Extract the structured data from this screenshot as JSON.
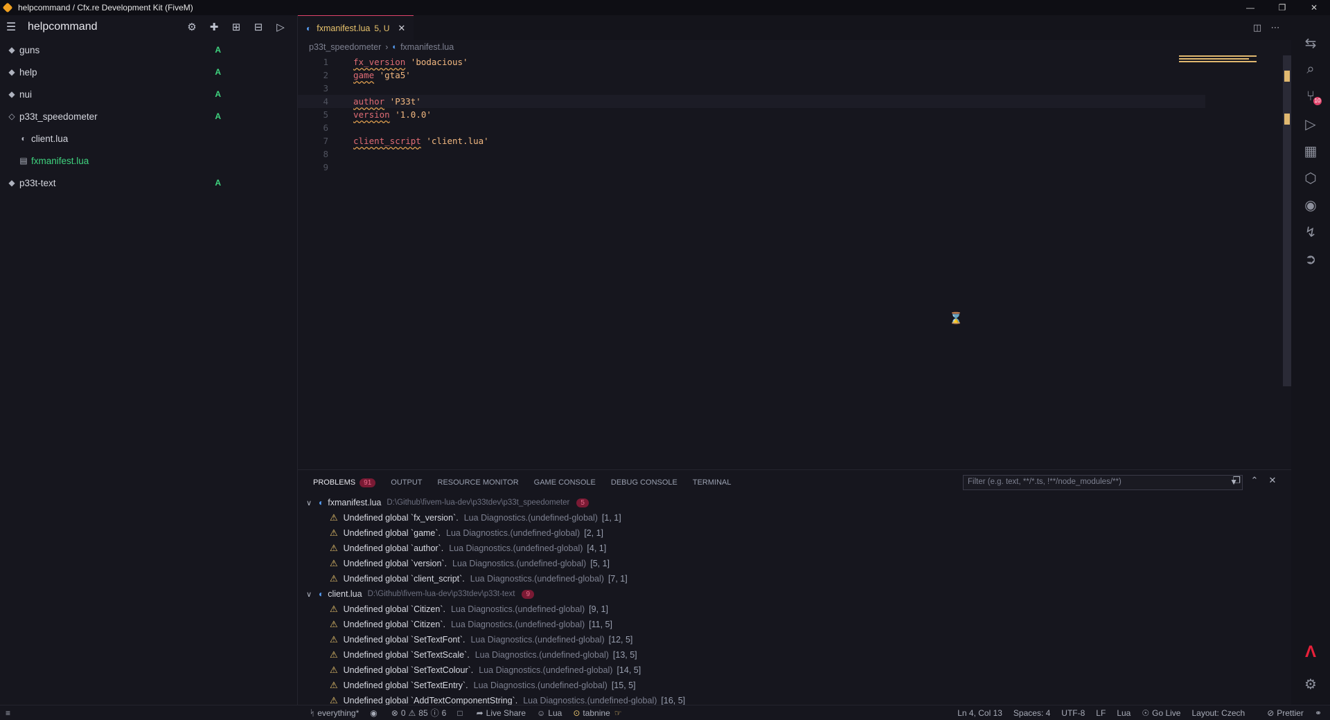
{
  "window": {
    "title": "helpcommand / Cfx.re Development Kit (FiveM)",
    "icon": "cfx-icon",
    "controls": [
      "minimize-icon",
      "restore-icon",
      "close-icon"
    ]
  },
  "sidebar": {
    "title": "helpcommand",
    "actions": [
      "gear-icon",
      "plus-icon",
      "import-icon",
      "export-icon",
      "play-icon"
    ],
    "items": [
      {
        "label": "guns",
        "badge": "A",
        "icon": "resource-icon",
        "level": 0
      },
      {
        "label": "help",
        "badge": "A",
        "icon": "resource-icon",
        "level": 0
      },
      {
        "label": "nui",
        "badge": "A",
        "icon": "resource-icon",
        "level": 0
      },
      {
        "label": "p33t_speedometer",
        "badge": "A",
        "icon": "resource-open-icon",
        "level": 0
      },
      {
        "label": "client.lua",
        "badge": "",
        "icon": "lua-file-icon",
        "level": 1
      },
      {
        "label": "fxmanifest.lua",
        "badge": "",
        "icon": "manifest-file-icon",
        "level": 1,
        "active": true
      },
      {
        "label": "p33t-text",
        "badge": "A",
        "icon": "resource-icon",
        "level": 0
      }
    ]
  },
  "editor": {
    "tab": {
      "label": "fxmanifest.lua",
      "status": "5, U"
    },
    "breadcrumb": {
      "folder": "p33t_speedometer",
      "file": "fxmanifest.lua"
    },
    "lines": [
      {
        "n": "1",
        "kw": "fx_version",
        "rest": " 'bodacious'"
      },
      {
        "n": "2",
        "kw": "game",
        "rest": " 'gta5'"
      },
      {
        "n": "3",
        "kw": "",
        "rest": ""
      },
      {
        "n": "4",
        "kw": "author",
        "rest": " 'P33t'"
      },
      {
        "n": "5",
        "kw": "version",
        "rest": " '1.0.0'"
      },
      {
        "n": "6",
        "kw": "",
        "rest": ""
      },
      {
        "n": "7",
        "kw": "client_script",
        "rest": " 'client.lua'"
      },
      {
        "n": "8",
        "kw": "",
        "rest": ""
      },
      {
        "n": "9",
        "kw": "",
        "rest": ""
      }
    ]
  },
  "panel": {
    "tabs": [
      {
        "label": "PROBLEMS",
        "badge": "91",
        "active": true
      },
      {
        "label": "OUTPUT"
      },
      {
        "label": "RESOURCE MONITOR"
      },
      {
        "label": "GAME CONSOLE"
      },
      {
        "label": "DEBUG CONSOLE"
      },
      {
        "label": "TERMINAL"
      }
    ],
    "filter_placeholder": "Filter (e.g. text, **/*.ts, !**/node_modules/**)",
    "groups": [
      {
        "file": "fxmanifest.lua",
        "path": "D:\\Github\\fivem-lua-dev\\p33tdev\\p33t_speedometer",
        "count": "5",
        "items": [
          {
            "msg": "Undefined global `fx_version`.",
            "src": "Lua Diagnostics.(undefined-global)",
            "pos": "[1, 1]"
          },
          {
            "msg": "Undefined global `game`.",
            "src": "Lua Diagnostics.(undefined-global)",
            "pos": "[2, 1]"
          },
          {
            "msg": "Undefined global `author`.",
            "src": "Lua Diagnostics.(undefined-global)",
            "pos": "[4, 1]"
          },
          {
            "msg": "Undefined global `version`.",
            "src": "Lua Diagnostics.(undefined-global)",
            "pos": "[5, 1]"
          },
          {
            "msg": "Undefined global `client_script`.",
            "src": "Lua Diagnostics.(undefined-global)",
            "pos": "[7, 1]"
          }
        ]
      },
      {
        "file": "client.lua",
        "path": "D:\\Github\\fivem-lua-dev\\p33tdev\\p33t-text",
        "count": "9",
        "items": [
          {
            "msg": "Undefined global `Citizen`.",
            "src": "Lua Diagnostics.(undefined-global)",
            "pos": "[9, 1]"
          },
          {
            "msg": "Undefined global `Citizen`.",
            "src": "Lua Diagnostics.(undefined-global)",
            "pos": "[11, 5]"
          },
          {
            "msg": "Undefined global `SetTextFont`.",
            "src": "Lua Diagnostics.(undefined-global)",
            "pos": "[12, 5]"
          },
          {
            "msg": "Undefined global `SetTextScale`.",
            "src": "Lua Diagnostics.(undefined-global)",
            "pos": "[13, 5]"
          },
          {
            "msg": "Undefined global `SetTextColour`.",
            "src": "Lua Diagnostics.(undefined-global)",
            "pos": "[14, 5]"
          },
          {
            "msg": "Undefined global `SetTextEntry`.",
            "src": "Lua Diagnostics.(undefined-global)",
            "pos": "[15, 5]"
          },
          {
            "msg": "Undefined global `AddTextComponentString`.",
            "src": "Lua Diagnostics.(undefined-global)",
            "pos": "[16, 5]"
          }
        ]
      }
    ]
  },
  "activity": {
    "icons": [
      "explorer-icon",
      "search-icon",
      "source-control-icon",
      "run-debug-icon",
      "extensions-icon",
      "cfx-cube-icon",
      "spotify-icon",
      "lightning-icon",
      "live-share-icon"
    ],
    "scm_badge": "10"
  },
  "status": {
    "branch": "everything*",
    "errors": "0",
    "warnings": "85",
    "infos": "6",
    "live_share": "Live Share",
    "lang_left": "Lua",
    "tabnine": "tabnine",
    "position": "Ln 4, Col 13",
    "spaces": "Spaces: 4",
    "encoding": "UTF-8",
    "eol": "LF",
    "language": "Lua",
    "go_live": "Go Live",
    "layout": "Layout: Czech",
    "prettier": "Prettier"
  },
  "colors": {
    "accent_tab": "#e0436b",
    "added": "#3fd47f",
    "warning": "#e8c36c",
    "keyword": "#e06c75",
    "string": "#f2b880"
  }
}
